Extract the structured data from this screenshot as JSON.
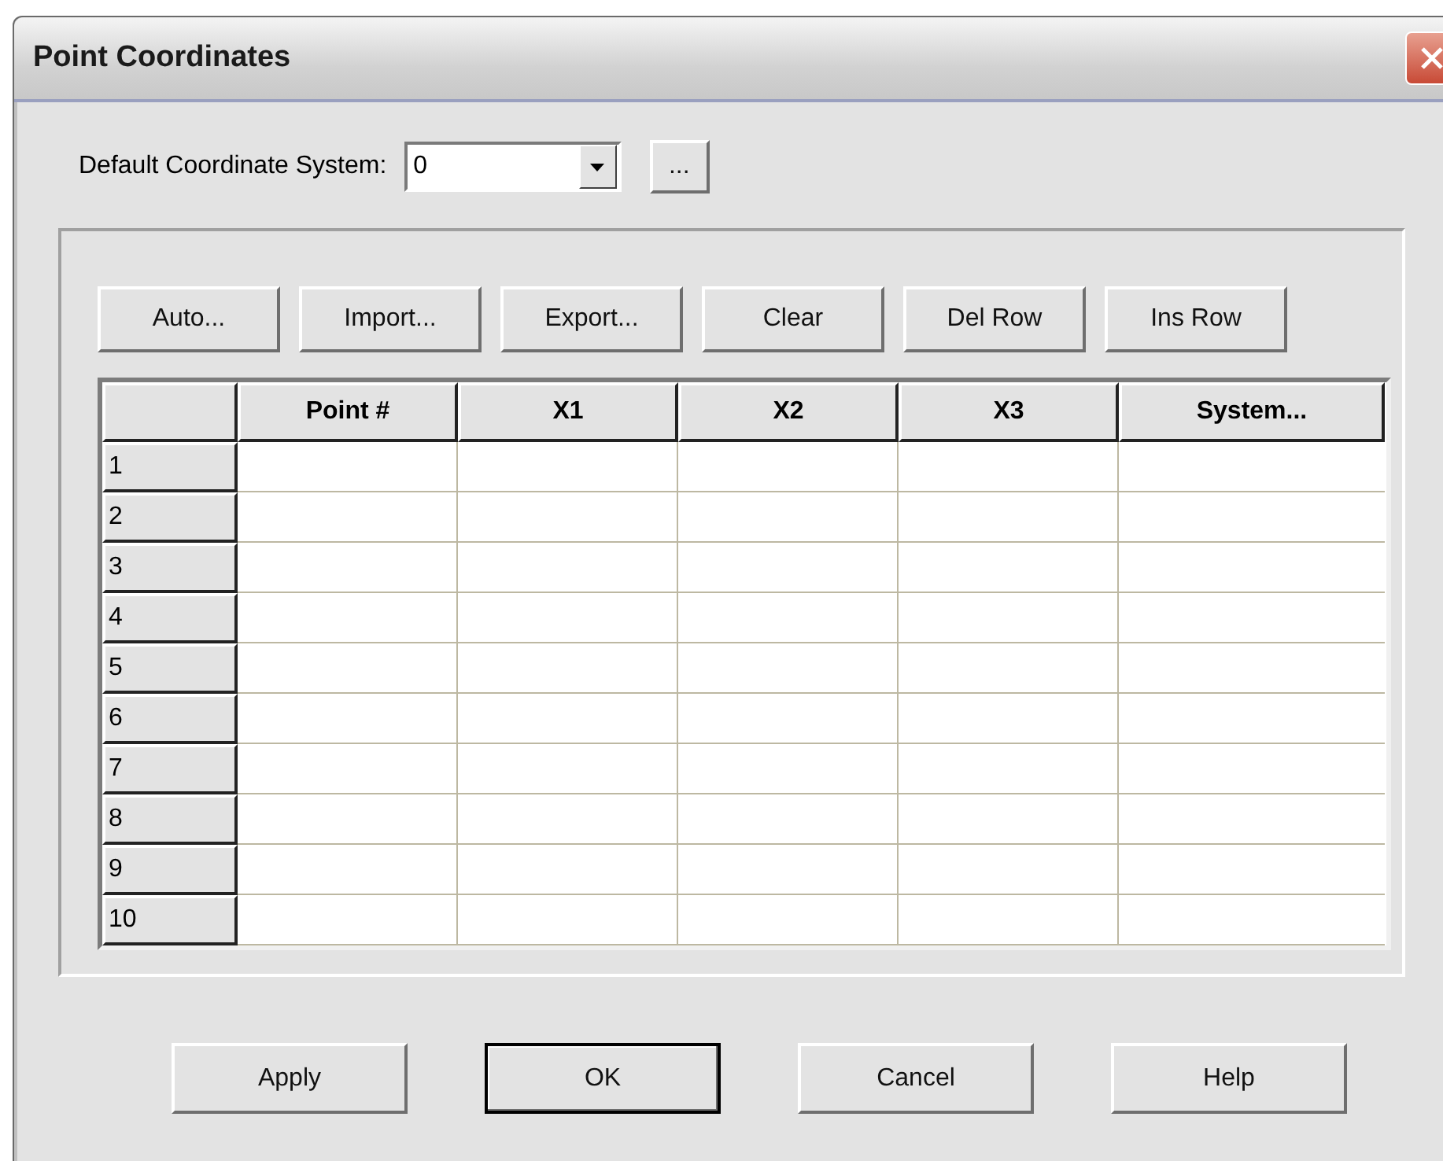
{
  "window": {
    "title": "Point Coordinates"
  },
  "default_system": {
    "label": "Default Coordinate System:",
    "value": "0",
    "browse": "..."
  },
  "toolbar": [
    "Auto...",
    "Import...",
    "Export...",
    "Clear",
    "Del Row",
    "Ins Row"
  ],
  "table": {
    "columns": [
      "Point #",
      "X1",
      "X2",
      "X3",
      "System..."
    ],
    "rows": [
      "1",
      "2",
      "3",
      "4",
      "5",
      "6",
      "7",
      "8",
      "9",
      "10"
    ]
  },
  "buttons": [
    {
      "label": "Apply",
      "default": false
    },
    {
      "label": "OK",
      "default": true
    },
    {
      "label": "Cancel",
      "default": false
    },
    {
      "label": "Help",
      "default": false
    }
  ]
}
